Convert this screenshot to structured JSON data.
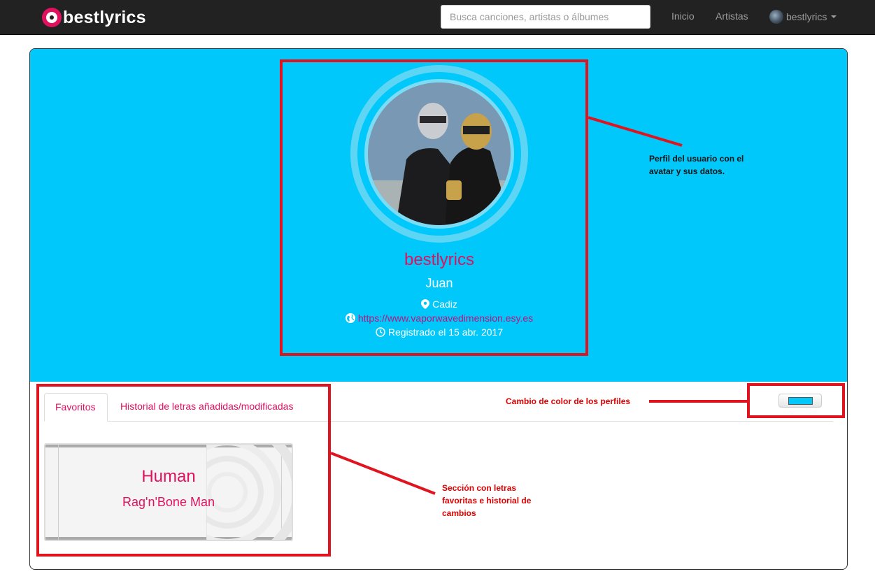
{
  "navbar": {
    "brand": "bestlyrics",
    "search_placeholder": "Busca canciones, artistas o álbumes",
    "links": [
      "Inicio",
      "Artistas"
    ],
    "user": "bestlyrics"
  },
  "profile": {
    "username": "bestlyrics",
    "name": "Juan",
    "location": "Cadiz",
    "website": "https://www.vaporwavedimension.esy.es",
    "registered": "Registrado el 15 abr. 2017",
    "theme_color": "#00c8fa"
  },
  "tabs": [
    {
      "label": "Favoritos",
      "active": true
    },
    {
      "label": "Historial de letras añadidas/modificadas",
      "active": false
    }
  ],
  "favorites": [
    {
      "title": "Human",
      "artist": "Rag'n'Bone Man"
    }
  ],
  "annotations": {
    "profile": "Perfil del usuario con el avatar y sus datos.",
    "color": "Cambio de color de los perfiles",
    "section": "Sección con letras favoritas e historial de cambios"
  },
  "colors": {
    "accent": "#e0115f",
    "annotation": "#e0141e",
    "navbar": "#222222"
  }
}
